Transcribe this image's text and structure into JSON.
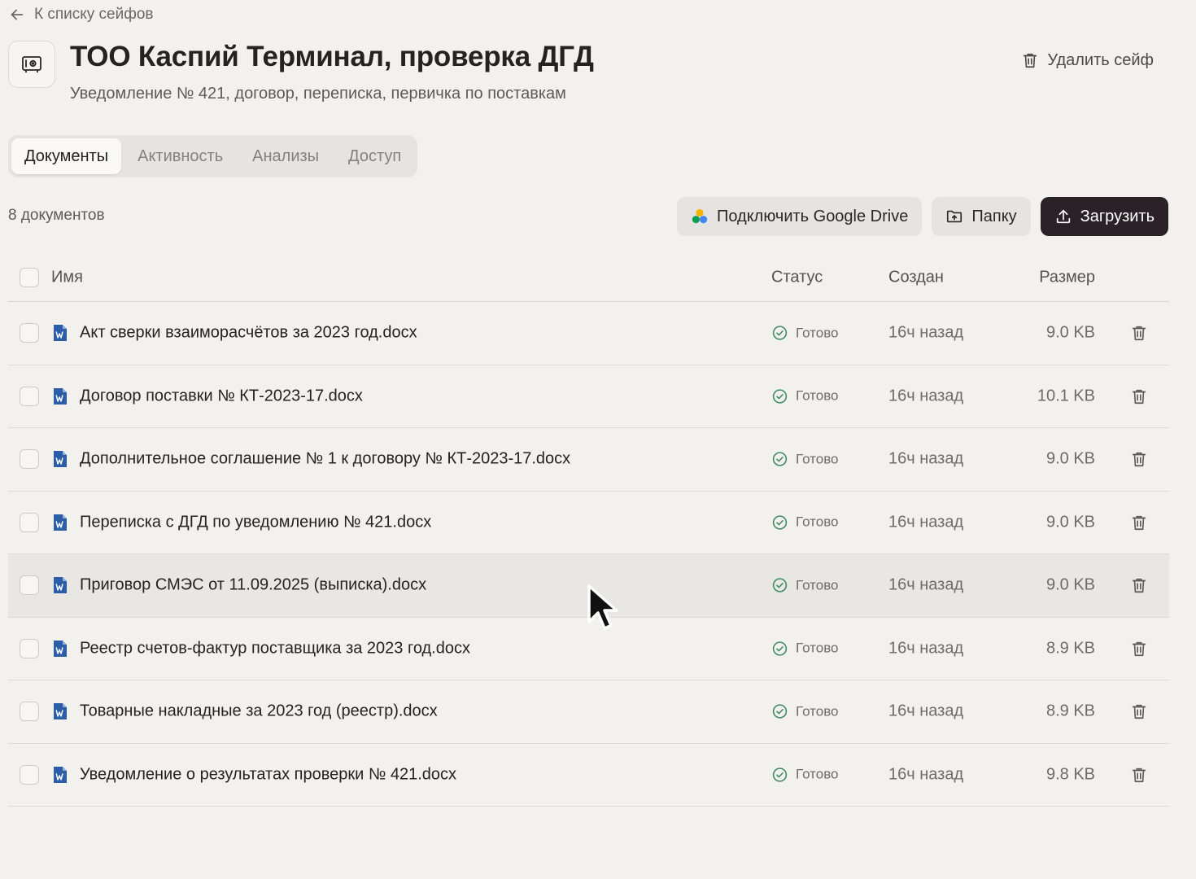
{
  "nav": {
    "back_label": "К списку сейфов"
  },
  "header": {
    "title": "ТОО Каспий Терминал, проверка ДГД",
    "subtitle": "Уведомление № 421, договор, переписка, первичка по поставкам",
    "delete_label": "Удалить сейф"
  },
  "tabs": [
    {
      "label": "Документы",
      "active": true
    },
    {
      "label": "Активность",
      "active": false
    },
    {
      "label": "Анализы",
      "active": false
    },
    {
      "label": "Доступ",
      "active": false
    }
  ],
  "toolbar": {
    "doc_count": "8 документов",
    "gdrive_label": "Подключить Google Drive",
    "folder_label": "Папку",
    "upload_label": "Загрузить"
  },
  "table": {
    "columns": {
      "name": "Имя",
      "status": "Статус",
      "created": "Создан",
      "size": "Размер"
    },
    "rows": [
      {
        "name": "Акт сверки взаиморасчётов за 2023 год.docx",
        "status": "Готово",
        "created": "16ч назад",
        "size": "9.0 KB"
      },
      {
        "name": "Договор поставки № КТ-2023-17.docx",
        "status": "Готово",
        "created": "16ч назад",
        "size": "10.1 KB"
      },
      {
        "name": "Дополнительное соглашение № 1 к договору № КТ-2023-17.docx",
        "status": "Готово",
        "created": "16ч назад",
        "size": "9.0 KB"
      },
      {
        "name": "Переписка с ДГД по уведомлению № 421.docx",
        "status": "Готово",
        "created": "16ч назад",
        "size": "9.0 KB"
      },
      {
        "name": "Приговор СМЭС от 11.09.2025 (выписка).docx",
        "status": "Готово",
        "created": "16ч назад",
        "size": "9.0 KB"
      },
      {
        "name": "Реестр счетов-фактур поставщика за 2023 год.docx",
        "status": "Готово",
        "created": "16ч назад",
        "size": "8.9 KB"
      },
      {
        "name": "Товарные накладные за 2023 год (реестр).docx",
        "status": "Готово",
        "created": "16ч назад",
        "size": "8.9 KB"
      },
      {
        "name": "Уведомление о результатах проверки № 421.docx",
        "status": "Готово",
        "created": "16ч назад",
        "size": "9.8 KB"
      }
    ]
  },
  "colors": {
    "background": "#f2f1ee",
    "primary_button": "#2a2226",
    "status_ok": "#3d8a63",
    "docx_icon": "#2b5ea7"
  },
  "icons": {
    "back": "arrow-left-icon",
    "vault": "safe-icon",
    "delete": "trash-icon",
    "gdrive": "google-drive-icon",
    "folder": "folder-upload-icon",
    "upload": "upload-icon",
    "file": "docx-file-icon",
    "status": "check-circle-icon"
  }
}
